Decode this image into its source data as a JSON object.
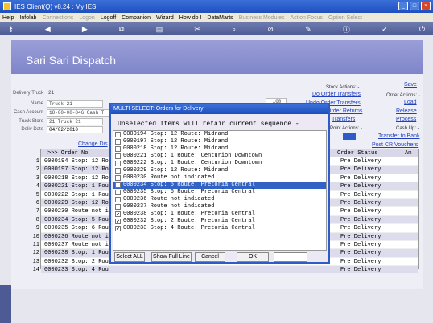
{
  "window": {
    "title": "IES Client(Q) v8.24 : My IES"
  },
  "menubar": [
    {
      "label": "Help",
      "enabled": true
    },
    {
      "label": "Infolab",
      "enabled": true
    },
    {
      "label": "Connections",
      "enabled": false
    },
    {
      "label": "Logon",
      "enabled": false
    },
    {
      "label": "Logoff",
      "enabled": true
    },
    {
      "label": "Companion",
      "enabled": true
    },
    {
      "label": "Wizard",
      "enabled": true
    },
    {
      "label": "How do I",
      "enabled": true
    },
    {
      "label": "DataMarts",
      "enabled": true
    },
    {
      "label": "Business Modules",
      "enabled": false
    },
    {
      "label": "Action Focus",
      "enabled": false
    },
    {
      "label": "Option Select",
      "enabled": false
    }
  ],
  "header": {
    "title": "Sari Sari Dispatch"
  },
  "form": {
    "delivery_truck_label": "Delivery Truck",
    "delivery_truck_value": "21",
    "name_label": "Name",
    "name_value": "Truck 21",
    "cash_account_label": "Cash Account",
    "cash_account_value": "18-00-00-846 Cash T",
    "truck_store_label": "Truck Store",
    "truck_store_value": "21 Truck 21",
    "deliv_date_label": "Deliv Date",
    "deliv_date_value": "04/02/2010",
    "qty_value": "100",
    "change_link": "Change Dis"
  },
  "actions": {
    "save": "Save",
    "stock_actions": "Stock Actions: -",
    "do_order_transfers": "Do Order Transfers",
    "undo_order_transfers": "Undo Order Transfers",
    "order_returns": "Order Returns",
    "transfers": "Transfers",
    "order_actions": "Order Actions: -",
    "load": "Load",
    "release": "Release",
    "process": "Process",
    "cash_up": "Cash Up: -",
    "point_actions": "Point Actions: -",
    "transfer_to_bank": "Transfer to Bank",
    "post_cr_vouchers": "Post CR Vouchers"
  },
  "grid": {
    "col_order": ">>> Order No",
    "col_status": "Order Status",
    "col_am": "Am",
    "rows": [
      {
        "n": "1",
        "order": "0000194 Stop: 12 Rou",
        "status": "Pre Delivery"
      },
      {
        "n": "2",
        "order": "0000197 Stop: 12 Rou",
        "status": "Pre Delivery"
      },
      {
        "n": "3",
        "order": "0000218 Stop: 12 Rou",
        "status": "Pre Delivery"
      },
      {
        "n": "4",
        "order": "0000221 Stop: 1 Rou",
        "status": "Pre Delivery"
      },
      {
        "n": "5",
        "order": "0000222 Stop: 1 Rou",
        "status": "Pre Delivery"
      },
      {
        "n": "6",
        "order": "0000229 Stop: 12 Rou",
        "status": "Pre Delivery"
      },
      {
        "n": "7",
        "order": "0000230 Route not i",
        "status": "Pre Delivery"
      },
      {
        "n": "8",
        "order": "0000234 Stop: 5 Rou",
        "status": "Pre Delivery"
      },
      {
        "n": "9",
        "order": "0000235 Stop: 6 Rou",
        "status": "Pre Delivery"
      },
      {
        "n": "10",
        "order": "0000236 Route not i",
        "status": "Pre Delivery"
      },
      {
        "n": "11",
        "order": "0000237 Route not i",
        "status": "Pre Delivery"
      },
      {
        "n": "12",
        "order": "0000238 Stop: 1 Rou",
        "status": "Pre Delivery"
      },
      {
        "n": "13",
        "order": "0000232 Stop: 2 Rou",
        "status": "Pre Delivery"
      },
      {
        "n": "14",
        "order": "0000233 Stop: 4 Rou",
        "status": "Pre Delivery"
      }
    ]
  },
  "modal": {
    "title": "MULTI SELECT: Orders for Delivery",
    "subtitle": "Unselected Items will retain current sequence -",
    "items": [
      {
        "text": "0000194 Stop: 12 Route: Midrand",
        "checked": false,
        "selected": false
      },
      {
        "text": "0000197 Stop: 12 Route: Midrand",
        "checked": false,
        "selected": false
      },
      {
        "text": "0000218 Stop: 12 Route: Midrand",
        "checked": false,
        "selected": false
      },
      {
        "text": "0000221 Stop: 1 Route: Centurion Downtown",
        "checked": false,
        "selected": false
      },
      {
        "text": "0000222 Stop: 1 Route: Centurion Downtown",
        "checked": false,
        "selected": false
      },
      {
        "text": "0000229 Stop: 12 Route: Midrand",
        "checked": false,
        "selected": false
      },
      {
        "text": "0000230 Route not indicated",
        "checked": false,
        "selected": false
      },
      {
        "text": "0000234 Stop: 5 Route: Pretoria Central",
        "checked": true,
        "selected": true
      },
      {
        "text": "0000235 Stop: 6 Route: Pretoria Central",
        "checked": false,
        "selected": false
      },
      {
        "text": "0000236 Route not indicated",
        "checked": false,
        "selected": false
      },
      {
        "text": "0000237 Route not indicated",
        "checked": false,
        "selected": false
      },
      {
        "text": "0000238 Stop: 1 Route: Pretoria Central",
        "checked": true,
        "selected": false
      },
      {
        "text": "0000232 Stop: 2 Route: Pretoria Central",
        "checked": true,
        "selected": false
      },
      {
        "text": "0000233 Stop: 4 Route: Pretoria Central",
        "checked": true,
        "selected": false
      }
    ],
    "select_all": "Select ALL",
    "show_full_line": "Show Full Line",
    "cancel": "Cancel",
    "ok": "OK"
  }
}
